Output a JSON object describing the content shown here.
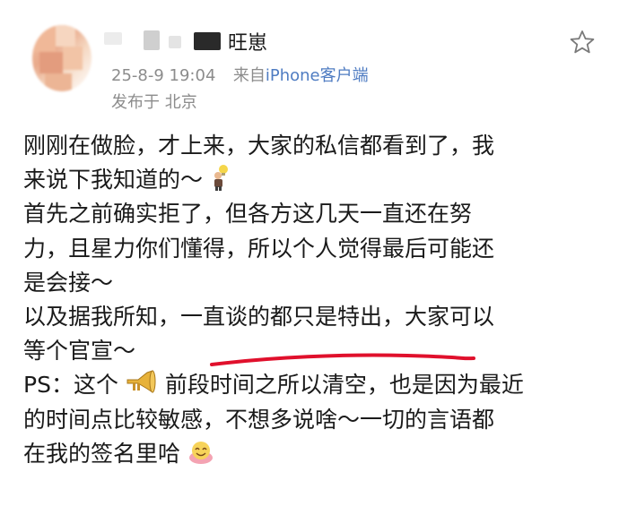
{
  "post_header": {
    "username": "旺崽",
    "timestamp": "25-8-9 19:04",
    "source_prefix": "来自",
    "source_device": "iPhone客户端",
    "location": "发布于 北京"
  },
  "post_body": {
    "lines": [
      "刚刚在做脸，才上来，大家的私信都看到了，我",
      "来说下我知道的～",
      "首先之前确实拒了，但各方这几天一直还在努",
      "力，且星力你们懂得，所以个人觉得最后可能还",
      "是会接～",
      "以及据我所知，一直谈的都只是特出，大家可以",
      "等个官宣～",
      "PS：这个",
      "前段时间之所以清空，也是因为最近",
      "的时间点比较敏感，不想多说啥～一切的言语都",
      "在我的签名里哈"
    ]
  },
  "icons": {
    "favorite": "star-outline-icon",
    "emoji_1": "person-with-lightbulb-emoji",
    "emoji_2": "trumpet-emoji",
    "emoji_3": "smiling-face-emoji"
  },
  "colors": {
    "link": "#4f7cc2",
    "meta_text": "#8c8c8c",
    "highlight_underline": "#e0102c"
  }
}
